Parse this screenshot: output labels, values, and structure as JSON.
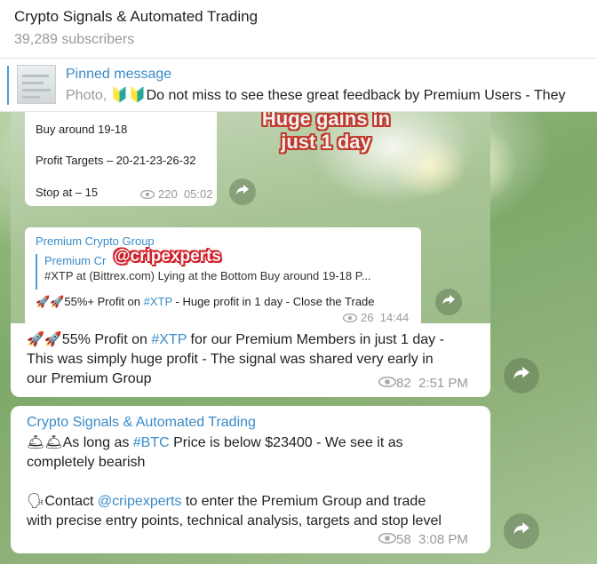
{
  "header": {
    "title": "Crypto Signals & Automated Trading",
    "subscribers": "39,289 subscribers"
  },
  "pinned": {
    "label": "Pinned message",
    "prefix": "Photo,",
    "emoji": "🔰🔰",
    "text": "Do not miss to see these great feedback by Premium Users - They"
  },
  "photo_post": {
    "overlay_line1": "Huge gains in",
    "overlay_line2": "just 1 day",
    "inner": {
      "line1": "Buy around 19-18",
      "line2": "Profit Targets – 20-21-23-26-32",
      "line3": "Stop at – 15",
      "views": "220",
      "time": "05:02"
    },
    "forward_card": {
      "from": "Premium Crypto Group",
      "quote_author": "Premium Cr",
      "quote_text": "#XTP at (Bittrex.com)  Lying at the Bottom  Buy around 19-18  P...",
      "watermark": "@cripexperts",
      "emoji": "🚀🚀",
      "msg_a": "55%+ Profit on ",
      "msg_tag": "#XTP",
      "msg_b": " - Huge profit in 1 day - Close the Trade",
      "views": "26",
      "time": "14:44"
    }
  },
  "message1": {
    "emoji": "🚀🚀",
    "line1_a": "55% Profit on ",
    "line1_tag": "#XTP",
    "line1_b": " for our Premium Members in just 1 day -",
    "line2": "This was simply huge profit - The signal was shared very early in",
    "line3": "our Premium Group",
    "views": "82",
    "time": "2:51 PM"
  },
  "message2": {
    "author": "Crypto Signals & Automated Trading",
    "emoji1": "🛎🛎",
    "line1_a": "As long as ",
    "line1_tag": "#BTC",
    "line1_b": " Price is below $23400 - We see it as",
    "line2": "completely bearish",
    "emoji2": "🗣",
    "line3_a": "Contact ",
    "line3_link": "@cripexperts",
    "line3_b": " to enter the Premium Group and trade",
    "line4": "with precise entry points, technical analysis, targets and stop level",
    "views": "58",
    "time": "3:08 PM"
  }
}
